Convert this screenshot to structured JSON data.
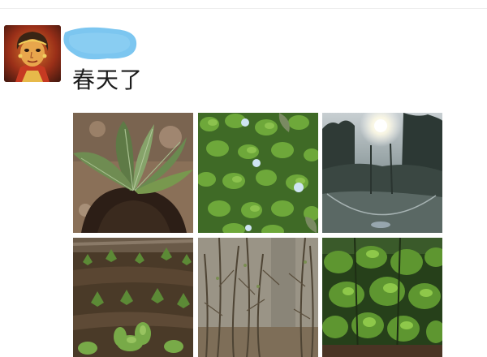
{
  "post": {
    "author_avatar": "painted-figure-avatar",
    "author_name_redacted": true,
    "redaction_color": "#7cc6f0",
    "text": "春天了",
    "photos": [
      {
        "subject": "plant-in-soil"
      },
      {
        "subject": "leafy-ground-cover"
      },
      {
        "subject": "sunlit-trees-lens-flare"
      },
      {
        "subject": "garden-seedlings"
      },
      {
        "subject": "bare-branches"
      },
      {
        "subject": "green-shrubs"
      }
    ]
  }
}
